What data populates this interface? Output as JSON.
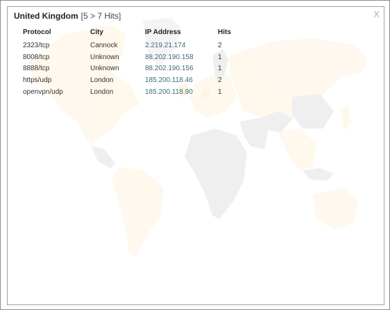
{
  "dialog": {
    "country": "United Kingdom",
    "hits_summary": "[5 > 7 Hits]",
    "close_label": "X"
  },
  "table": {
    "headers": [
      "Protocol",
      "City",
      "IP Address",
      "Hits"
    ],
    "rows": [
      {
        "protocol": "2323/tcp",
        "city": "Cannock",
        "ip": "2.219.21.174",
        "hits": "2"
      },
      {
        "protocol": "8008/tcp",
        "city": "Unknown",
        "ip": "88.202.190.158",
        "hits": "1"
      },
      {
        "protocol": "8888/tcp",
        "city": "Unknown",
        "ip": "88.202.190.156",
        "hits": "1"
      },
      {
        "protocol": "https/udp",
        "city": "London",
        "ip": "185.200.118.46",
        "hits": "2"
      },
      {
        "protocol": "openvpn/udp",
        "city": "London",
        "ip": "185.200.118.90",
        "hits": "1"
      }
    ]
  },
  "colors": {
    "land_gray": "#e9e9e9",
    "land_highlight": "#fdf1dc",
    "ip_link": "#3b6b76"
  }
}
